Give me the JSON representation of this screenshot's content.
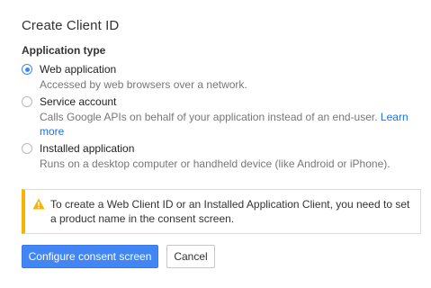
{
  "dialog": {
    "title": "Create Client ID",
    "section_label": "Application type",
    "options": [
      {
        "label": "Web application",
        "description": "Accessed by web browsers over a network.",
        "selected": true
      },
      {
        "label": "Service account",
        "description": "Calls Google APIs on behalf of your application instead of an end-user.",
        "link_text": "Learn more",
        "selected": false
      },
      {
        "label": "Installed application",
        "description": "Runs on a desktop computer or handheld device (like Android or iPhone).",
        "selected": false
      }
    ],
    "alert": {
      "icon": "warning-icon",
      "text": "To create a Web Client ID or an Installed Application Client, you need to set a product name in the consent screen."
    },
    "buttons": {
      "configure": "Configure consent screen",
      "cancel": "Cancel"
    }
  },
  "colors": {
    "accent": "#4285f4",
    "link": "#1a73e8",
    "warning": "#f4b400"
  }
}
